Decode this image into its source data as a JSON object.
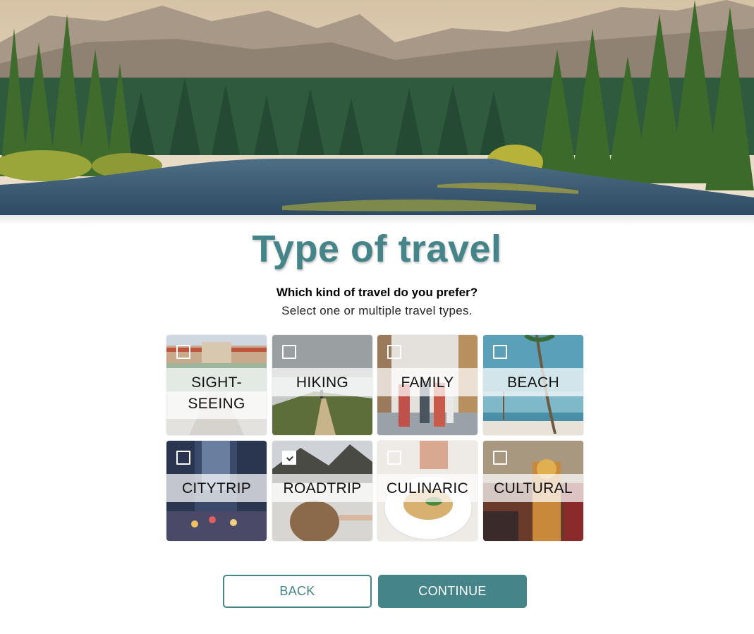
{
  "hero": {
    "image": "mountain-lake-forest-landscape"
  },
  "page": {
    "title": "Type of travel",
    "question": "Which kind of travel do you prefer?",
    "hint": "Select one or multiple travel types."
  },
  "travel_types": [
    {
      "label": "SIGHT-",
      "label2": "SEEING",
      "checked": false,
      "image": "palace-garden"
    },
    {
      "label": "HIKING",
      "checked": false,
      "image": "hiker-on-hill-path"
    },
    {
      "label": "FAMILY",
      "checked": false,
      "image": "family-walking-street"
    },
    {
      "label": "BEACH",
      "checked": false,
      "image": "palm-tree-beach"
    },
    {
      "label": "CITYTRIP",
      "checked": false,
      "image": "city-street-dusk"
    },
    {
      "label": "ROADTRIP",
      "checked": true,
      "image": "woman-hair-mountain-road"
    },
    {
      "label": "CULINARIC",
      "checked": false,
      "image": "plated-dish"
    },
    {
      "label": "CULTURAL",
      "checked": false,
      "image": "temple-statue"
    }
  ],
  "buttons": {
    "back": "BACK",
    "continue": "CONTINUE"
  },
  "colors": {
    "accent": "#458489"
  }
}
